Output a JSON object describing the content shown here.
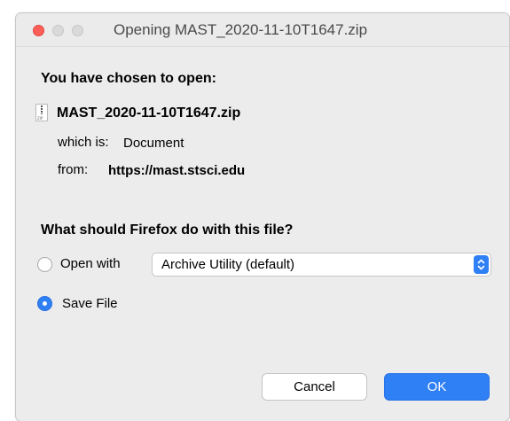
{
  "window": {
    "title": "Opening MAST_2020-11-10T1647.zip"
  },
  "dialog": {
    "heading": "You have chosen to open:",
    "file_icon": "zip-file-icon",
    "file_icon_ext": "ZIP",
    "filename": "MAST_2020-11-10T1647.zip",
    "type_label": "which is:",
    "type_value": "Document",
    "from_label": "from:",
    "from_value": "https://mast.stsci.edu",
    "question": "What should Firefox do with this file?",
    "options": {
      "open_with_label": "Open with",
      "open_with_selected": false,
      "app_value": "Archive Utility (default)",
      "save_file_label": "Save File",
      "save_file_selected": true
    },
    "buttons": {
      "cancel": "Cancel",
      "ok": "OK"
    }
  },
  "colors": {
    "accent": "#2f7ff5",
    "close": "#fd5e57",
    "window_bg": "#ececec"
  }
}
